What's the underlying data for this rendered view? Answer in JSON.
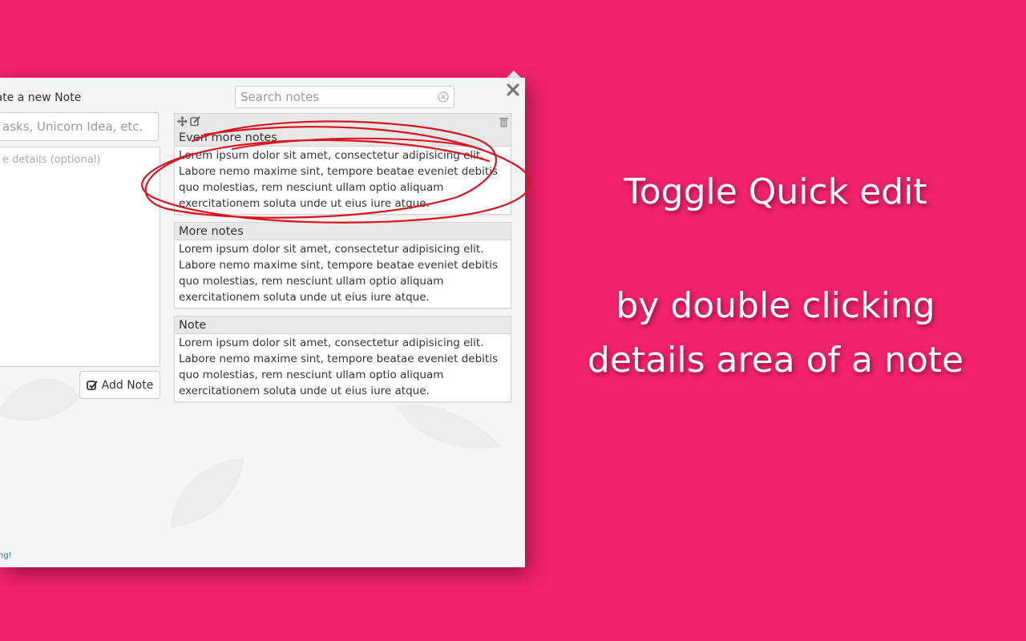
{
  "popup": {
    "create_title": "eate a new Note",
    "title_placeholder": "asks, Unicorn Idea, etc.",
    "details_placeholder": "e details (optional)",
    "add_button_label": "Add Note",
    "footer_link": "ng!",
    "search_placeholder": "Search notes"
  },
  "notes": [
    {
      "title": "Even more notes",
      "body": "Lorem ipsum dolor sit amet, consectetur adipisicing elit. Labore nemo maxime sint, tempore beatae eveniet debitis quo molestias, rem nesciunt ullam optio aliquam exercitationem soluta unde ut eius iure atque."
    },
    {
      "title": "More notes",
      "body": "Lorem ipsum dolor sit amet, consectetur adipisicing elit. Labore nemo maxime sint, tempore beatae eveniet debitis quo molestias, rem nesciunt ullam optio aliquam exercitationem soluta unde ut eius iure atque."
    },
    {
      "title": "Note",
      "body": "Lorem ipsum dolor sit amet, consectetur adipisicing elit. Labore nemo maxime sint, tempore beatae eveniet debitis quo molestias, rem nesciunt ullam optio aliquam exercitationem soluta unde ut eius iure atque."
    }
  ],
  "caption": {
    "line1": "Toggle Quick edit",
    "line2": "by double clicking details area of a note"
  },
  "icons": {
    "move": "move-icon",
    "edit": "edit-icon",
    "trash": "trash-icon",
    "close": "close-icon",
    "clear": "clear-search-icon",
    "checkbox": "check-square-icon"
  },
  "colors": {
    "background": "#f2226b",
    "annotation": "#d9141f",
    "panel": "#f5f5f5"
  }
}
